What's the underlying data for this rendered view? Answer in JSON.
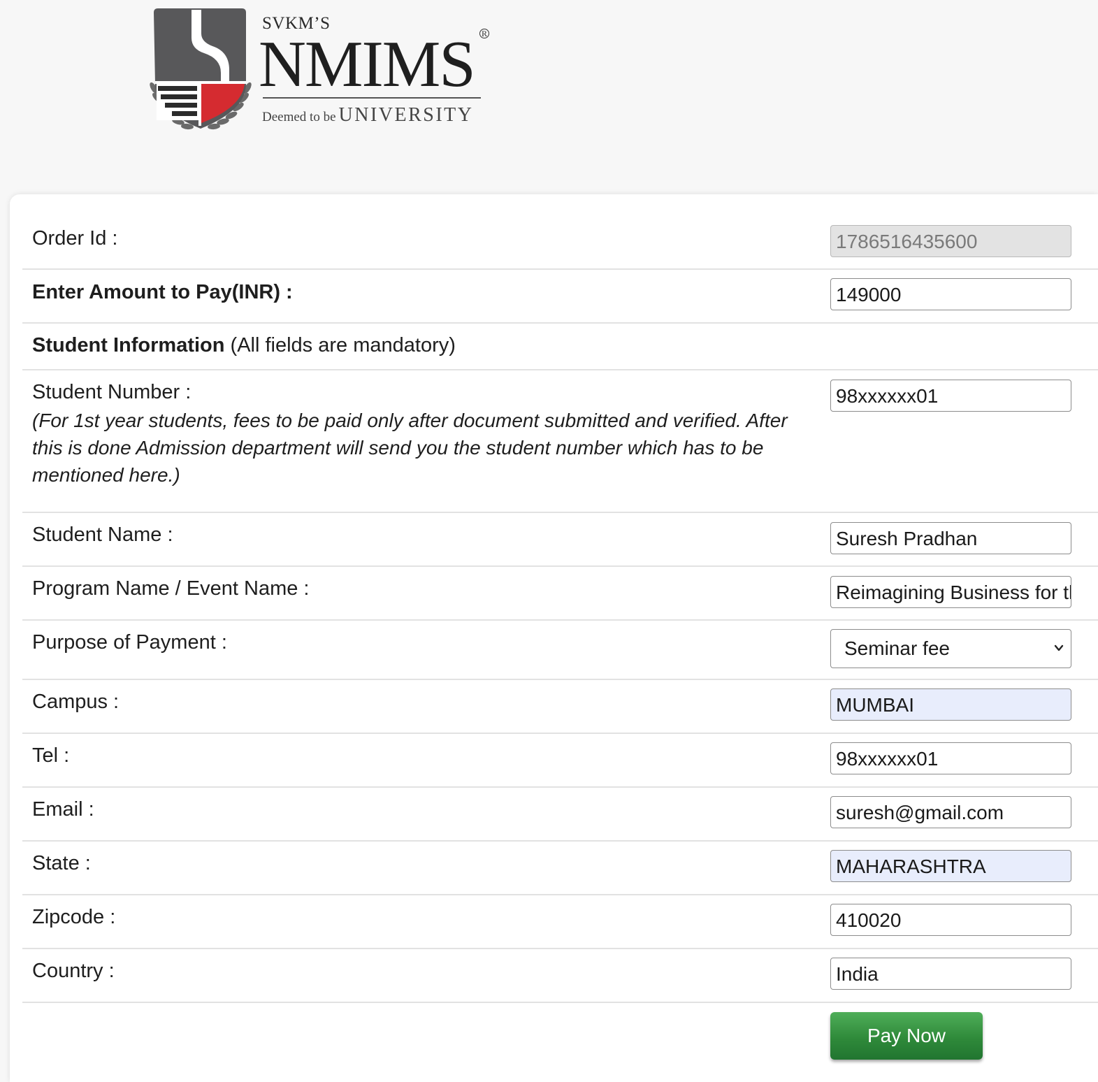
{
  "logo": {
    "svkm": "SVKM’S",
    "name": "NMIMS",
    "registered_mark": "R",
    "tagline_small": "Deemed to be",
    "tagline_big": "UNIVERSITY"
  },
  "form": {
    "order_id": {
      "label": "Order Id :",
      "value": "1786516435600"
    },
    "amount": {
      "label": "Enter Amount to Pay(INR) :",
      "value": "149000"
    },
    "student_info": {
      "heading": "Student Information",
      "note": " (All fields are mandatory)"
    },
    "student_number": {
      "label": "Student Number :",
      "note": "(For 1st year students, fees to be paid only after document submitted and verified. After this is done Admission department will send you the student number which has to be mentioned here.)",
      "value": "98xxxxxx01"
    },
    "student_name": {
      "label": "Student Name :",
      "value": "Suresh Pradhan"
    },
    "program_name": {
      "label": "Program Name / Event Name :",
      "value": "Reimagining Business for th"
    },
    "purpose": {
      "label": "Purpose of Payment :",
      "selected": "Seminar fee"
    },
    "campus": {
      "label": "Campus :",
      "value": "MUMBAI"
    },
    "tel": {
      "label": "Tel :",
      "value": "98xxxxxx01"
    },
    "email": {
      "label": "Email :",
      "value": "suresh@gmail.com"
    },
    "state": {
      "label": "State :",
      "value": "MAHARASHTRA"
    },
    "zipcode": {
      "label": "Zipcode :",
      "value": "410020"
    },
    "country": {
      "label": "Country :",
      "value": "India"
    },
    "pay_button": "Pay Now"
  },
  "colors": {
    "crest_gray": "#58585a",
    "crest_red": "#d52b30",
    "pay_green": "#2f8a3a",
    "autofill_blue": "#e8edfc"
  },
  "icons": {
    "select_arrow": "chevron-down-icon",
    "crest": "university-crest-icon"
  }
}
